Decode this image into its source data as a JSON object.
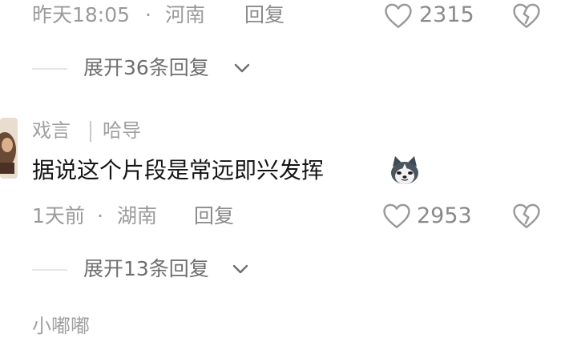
{
  "comment1": {
    "timestamp": "昨天18:05",
    "location": "河南",
    "reply_label": "回复",
    "likes": "2315",
    "expand_label": "展开36条回复"
  },
  "comment2": {
    "author": "戏言",
    "author_tag": "哈导",
    "text": "据说这个片段是常远即兴发挥",
    "emoji": "husky-face-emoji",
    "timestamp": "1天前",
    "location": "湖南",
    "reply_label": "回复",
    "likes": "2953",
    "expand_label": "展开13条回复"
  },
  "comment3": {
    "author": "小嘟嘟"
  },
  "separator_dot": "·",
  "icons": {
    "like": "heart-outline-icon",
    "dislike": "broken-heart-icon",
    "expand": "chevron-down-icon"
  }
}
